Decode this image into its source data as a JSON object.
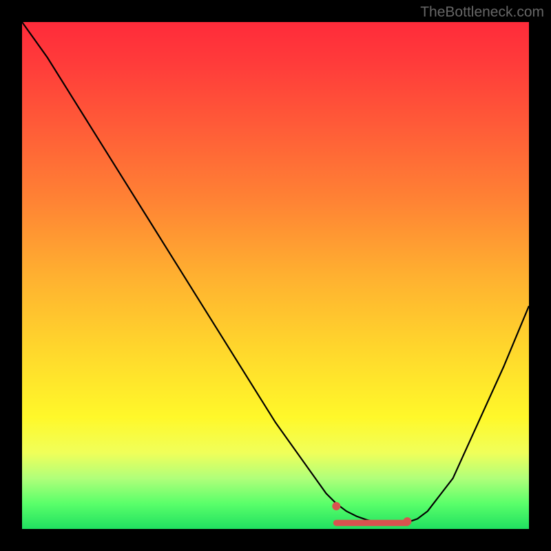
{
  "attribution": "TheBottleneck.com",
  "chart_data": {
    "type": "line",
    "title": "",
    "xlabel": "",
    "ylabel": "",
    "xlim": [
      0,
      100
    ],
    "ylim": [
      0,
      100
    ],
    "x": [
      0,
      5,
      10,
      15,
      20,
      25,
      30,
      35,
      40,
      45,
      50,
      55,
      60,
      62,
      64,
      66,
      68,
      70,
      72,
      74,
      76,
      78,
      80,
      85,
      90,
      95,
      100
    ],
    "values": [
      100,
      93,
      85,
      77,
      69,
      61,
      53,
      45,
      37,
      29,
      21,
      14,
      7,
      5,
      3.5,
      2.5,
      1.8,
      1.3,
      1.0,
      1.0,
      1.3,
      2.0,
      3.5,
      10,
      21,
      32,
      44
    ],
    "series": [
      {
        "name": "bottleneck-curve",
        "color": "#000000",
        "x": [
          0,
          5,
          10,
          15,
          20,
          25,
          30,
          35,
          40,
          45,
          50,
          55,
          60,
          62,
          64,
          66,
          68,
          70,
          72,
          74,
          76,
          78,
          80,
          85,
          90,
          95,
          100
        ],
        "y": [
          100,
          93,
          85,
          77,
          69,
          61,
          53,
          45,
          37,
          29,
          21,
          14,
          7,
          5,
          3.5,
          2.5,
          1.8,
          1.3,
          1.0,
          1.0,
          1.3,
          2.0,
          3.5,
          10,
          21,
          32,
          44
        ]
      }
    ],
    "markers": [
      {
        "x": 62,
        "y": 4.5,
        "color": "#d9534f"
      },
      {
        "x": 76,
        "y": 1.5,
        "color": "#d9534f"
      }
    ],
    "trough_band": {
      "x_start": 62,
      "x_end": 76,
      "y": 1.2,
      "color": "#d9534f"
    },
    "background_gradient": {
      "top": "#ff2b3a",
      "mid": "#ffd82c",
      "bottom": "#20e060"
    }
  }
}
